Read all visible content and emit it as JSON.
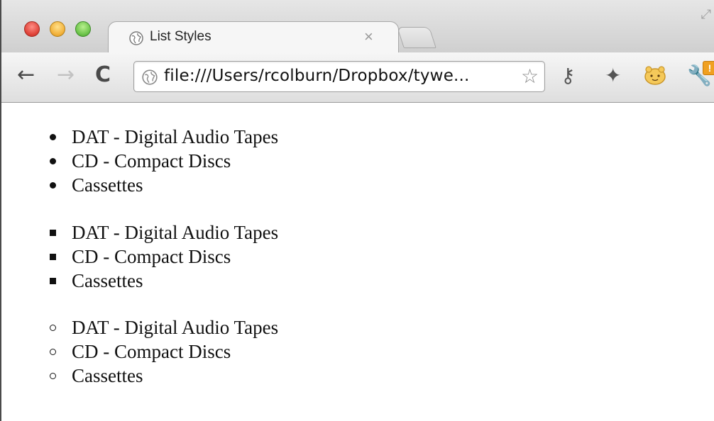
{
  "browser": {
    "tab_title": "List Styles",
    "url": "file:///Users/rcolburn/Dropbox/tywe...",
    "extension_badge": "!"
  },
  "lists": [
    {
      "marker": "disc",
      "items": [
        "DAT - Digital Audio Tapes",
        "CD - Compact Discs",
        "Cassettes"
      ]
    },
    {
      "marker": "square",
      "items": [
        "DAT - Digital Audio Tapes",
        "CD - Compact Discs",
        "Cassettes"
      ]
    },
    {
      "marker": "circle",
      "items": [
        "DAT - Digital Audio Tapes",
        "CD - Compact Discs",
        "Cassettes"
      ]
    }
  ],
  "icons": {
    "back": "back-arrow-icon",
    "forward": "forward-arrow-icon",
    "reload": "reload-icon",
    "bookmark": "star-icon",
    "key": "key-icon",
    "pin": "pin-icon",
    "extension": "extension-icon",
    "settings": "wrench-icon"
  },
  "colors": {
    "close_red": "#e0443a",
    "minimize_yellow": "#f2b13a",
    "zoom_green": "#6cc44a",
    "badge_orange": "#f0a020"
  }
}
